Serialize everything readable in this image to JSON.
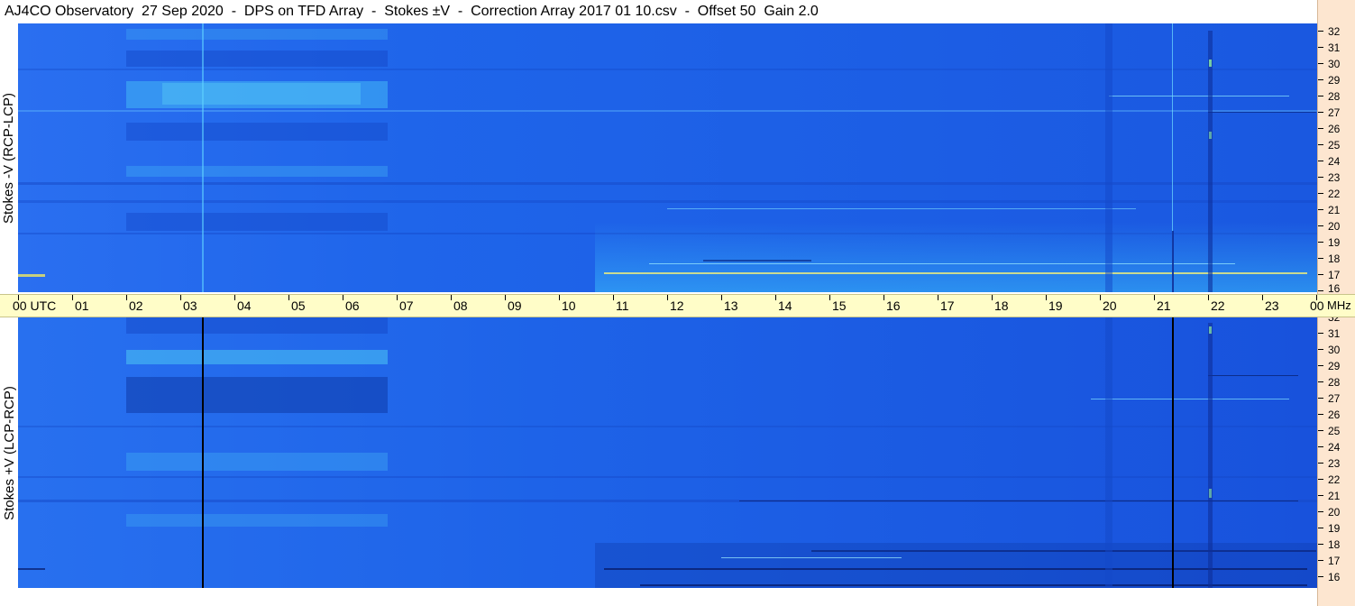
{
  "title": "AJ4CO Observatory  27 Sep 2020  -  DPS on TFD Array  -  Stokes ±V  -  Correction Array 2017 01 10.csv  -  Offset 50  Gain 2.0",
  "panels": {
    "top": {
      "label": "Stokes -V (RCP-LCP)"
    },
    "bottom": {
      "label": "Stokes +V (LCP-RCP)"
    }
  },
  "time_axis": {
    "labels": [
      "00  UTC",
      "01",
      "02",
      "03",
      "04",
      "05",
      "06",
      "07",
      "08",
      "09",
      "10",
      "11",
      "12",
      "13",
      "14",
      "15",
      "16",
      "17",
      "18",
      "19",
      "20",
      "21",
      "22",
      "23",
      "00"
    ],
    "unit": "MHz"
  },
  "freq_scale": {
    "labels": [
      "32",
      "31",
      "30",
      "29",
      "28",
      "27",
      "26",
      "25",
      "24",
      "23",
      "22",
      "21",
      "20",
      "19",
      "18",
      "17",
      "16"
    ]
  },
  "colors": {
    "spectrogram_base": "#1c5fe6",
    "time_axis_bg": "#fffdc8",
    "scale_bg": "#fde6d0"
  }
}
